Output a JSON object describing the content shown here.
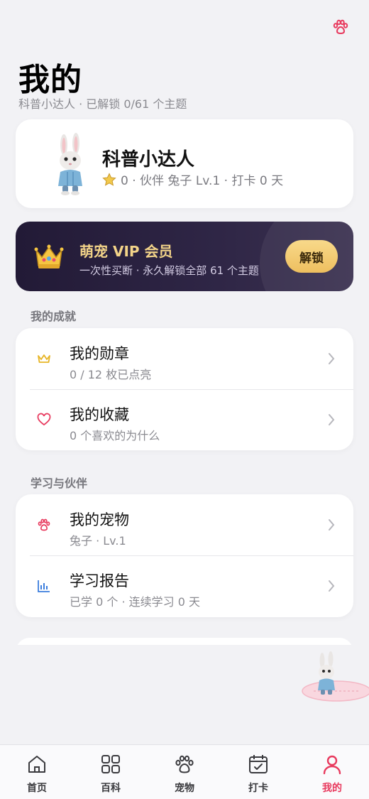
{
  "header": {
    "title": "我的",
    "subtitle": "科普小达人 · 已解锁 0/61 个主题",
    "top_icon": "paw-icon"
  },
  "profile": {
    "name": "科普小达人",
    "stats": "0 · 伙伴 兔子 Lv.1 · 打卡 0 天",
    "avatar_icon": "rabbit-avatar"
  },
  "vip": {
    "title": "萌宠 VIP 会员",
    "desc": "一次性买断 · 永久解锁全部 61 个主题",
    "button": "解锁",
    "accent": "#f3d489"
  },
  "sections": {
    "achievements": {
      "title": "我的成就",
      "items": [
        {
          "title": "我的勋章",
          "sub": "0 / 12 枚已点亮",
          "icon": "crown-outline-icon"
        },
        {
          "title": "我的收藏",
          "sub": "0 个喜欢的为什么",
          "icon": "heart-icon"
        }
      ]
    },
    "learning": {
      "title": "学习与伙伴",
      "items": [
        {
          "title": "我的宠物",
          "sub": "兔子 · Lv.1",
          "icon": "paw-icon"
        },
        {
          "title": "学习报告",
          "sub": "已学 0 个 · 连续学习 0 天",
          "icon": "bar-chart-icon"
        }
      ]
    }
  },
  "tabs": [
    {
      "label": "首页",
      "icon": "home-icon",
      "active": false
    },
    {
      "label": "百科",
      "icon": "grid-icon",
      "active": false
    },
    {
      "label": "宠物",
      "icon": "paw-icon",
      "active": false
    },
    {
      "label": "打卡",
      "icon": "calendar-check-icon",
      "active": false
    },
    {
      "label": "我的",
      "icon": "user-icon",
      "active": true
    }
  ],
  "colors": {
    "accent": "#e83a5e",
    "background": "#f2f2f5",
    "vip_bg": "#2a2140"
  }
}
